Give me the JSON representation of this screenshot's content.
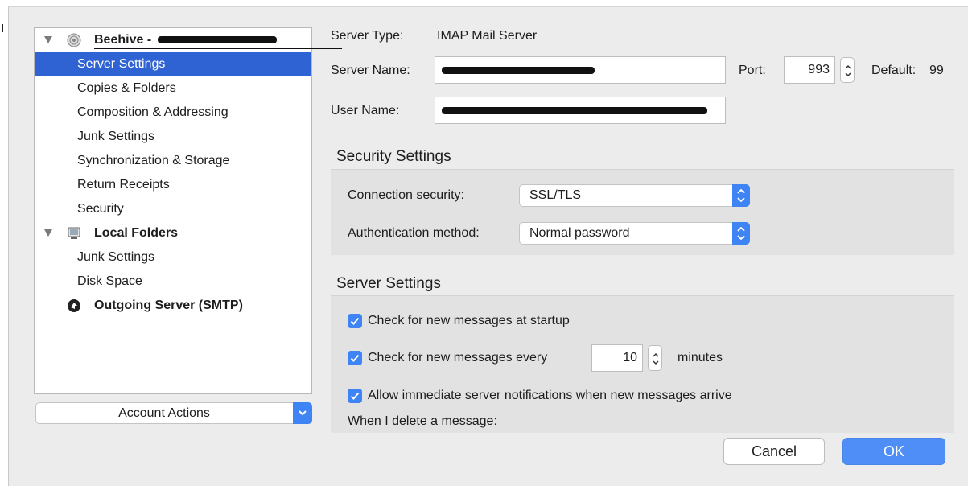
{
  "sidebar": {
    "accounts": [
      {
        "name": "Beehive -",
        "items": [
          "Server Settings",
          "Copies & Folders",
          "Composition & Addressing",
          "Junk Settings",
          "Synchronization & Storage",
          "Return Receipts",
          "Security"
        ]
      },
      {
        "name": "Local Folders",
        "items": [
          "Junk Settings",
          "Disk Space"
        ]
      },
      {
        "name": "Outgoing Server (SMTP)",
        "items": []
      }
    ],
    "account_actions_label": "Account Actions"
  },
  "server": {
    "type_label": "Server Type:",
    "type_value": "IMAP Mail Server",
    "name_label": "Server Name:",
    "port_label": "Port:",
    "port_value": "993",
    "default_label": "Default:",
    "default_value": "99",
    "user_label": "User Name:"
  },
  "security": {
    "title": "Security Settings",
    "connection_label": "Connection security:",
    "connection_value": "SSL/TLS",
    "auth_label": "Authentication method:",
    "auth_value": "Normal password"
  },
  "server_settings": {
    "title": "Server Settings",
    "check_startup": "Check for new messages at startup",
    "check_every": "Check for new messages every",
    "interval_value": "10",
    "interval_unit": "minutes",
    "allow_notifications": "Allow immediate server notifications when new messages arrive",
    "delete_label": "When I delete a message:"
  },
  "buttons": {
    "cancel": "Cancel",
    "ok": "OK"
  },
  "colors": {
    "selection": "#2f63d3",
    "accent": "#3f84f5",
    "ok": "#4f8ef7"
  }
}
